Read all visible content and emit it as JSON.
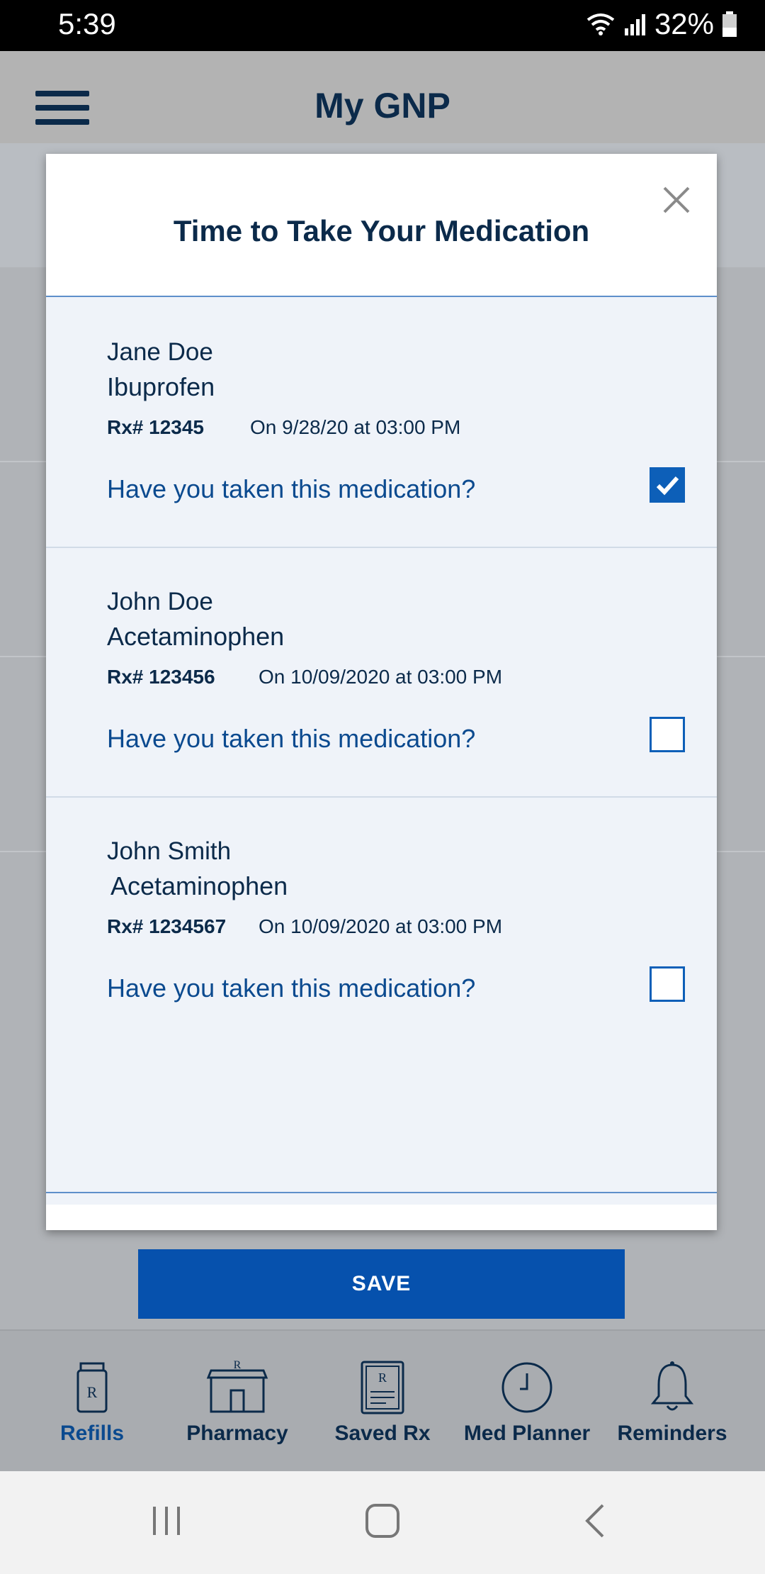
{
  "status": {
    "time": "5:39",
    "battery": "32%"
  },
  "header": {
    "title": "My GNP"
  },
  "modal": {
    "title": "Time to Take Your Medication",
    "items": [
      {
        "patient": "Jane Doe",
        "drug": "Ibuprofen",
        "rx": "Rx# 12345",
        "date": "On 9/28/20 at 03:00 PM",
        "question": "Have you taken this medication?",
        "checked": true
      },
      {
        "patient": "John Doe",
        "drug": "Acetaminophen",
        "rx": "Rx# 123456",
        "date": "On 10/09/2020 at 03:00 PM",
        "question": "Have you taken this medication?",
        "checked": false
      },
      {
        "patient": "John Smith",
        "drug": "Acetaminophen",
        "rx": "Rx# 1234567",
        "date": "On 10/09/2020 at 03:00 PM",
        "question": "Have you taken this medication?",
        "checked": false
      }
    ],
    "save_label": "SAVE"
  },
  "nav": {
    "items": [
      {
        "label": "Refills",
        "icon": "rx-bottle-icon",
        "active": true
      },
      {
        "label": "Pharmacy",
        "icon": "pharmacy-icon",
        "active": false
      },
      {
        "label": "Saved Rx",
        "icon": "saved-rx-icon",
        "active": false
      },
      {
        "label": "Med Planner",
        "icon": "clock-icon",
        "active": false
      },
      {
        "label": "Reminders",
        "icon": "bell-icon",
        "active": false
      }
    ]
  },
  "colors": {
    "brand_navy": "#0b2a4a",
    "accent_blue": "#0651ad",
    "checkbox_blue": "#0d5fb8"
  }
}
